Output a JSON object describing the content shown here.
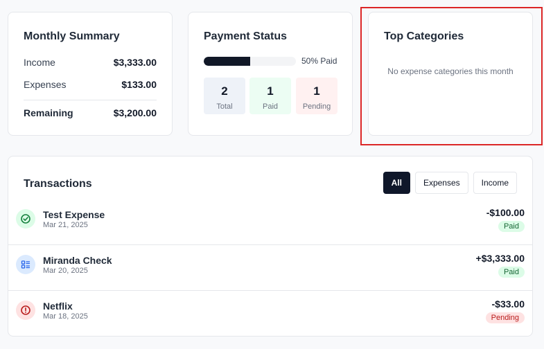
{
  "summary": {
    "title": "Monthly Summary",
    "income_label": "Income",
    "income_value": "$3,333.00",
    "expenses_label": "Expenses",
    "expenses_value": "$133.00",
    "remaining_label": "Remaining",
    "remaining_value": "$3,200.00"
  },
  "payment": {
    "title": "Payment Status",
    "paid_fraction": 0.5,
    "paid_text": "50% Paid",
    "total_count": "2",
    "total_label": "Total",
    "paid_count": "1",
    "paid_label": "Paid",
    "pending_count": "1",
    "pending_label": "Pending"
  },
  "categories": {
    "title": "Top Categories",
    "empty_text": "No expense categories this month"
  },
  "transactions": {
    "title": "Transactions",
    "filters": [
      "All",
      "Expenses",
      "Income"
    ],
    "items": [
      {
        "name": "Test Expense",
        "date": "Mar 21, 2025",
        "amount": "-$100.00",
        "status": "Paid",
        "icon": "check-circle-icon",
        "icon_color": "#15803d",
        "icon_bg": "#dcfce7"
      },
      {
        "name": "Miranda Check",
        "date": "Mar 20, 2025",
        "amount": "+$3,333.00",
        "status": "Paid",
        "icon": "list-icon",
        "icon_color": "#2563eb",
        "icon_bg": "#dbeafe"
      },
      {
        "name": "Netflix",
        "date": "Mar 18, 2025",
        "amount": "-$33.00",
        "status": "Pending",
        "icon": "alert-circle-icon",
        "icon_color": "#b91c1c",
        "icon_bg": "#fee2e2"
      }
    ]
  }
}
